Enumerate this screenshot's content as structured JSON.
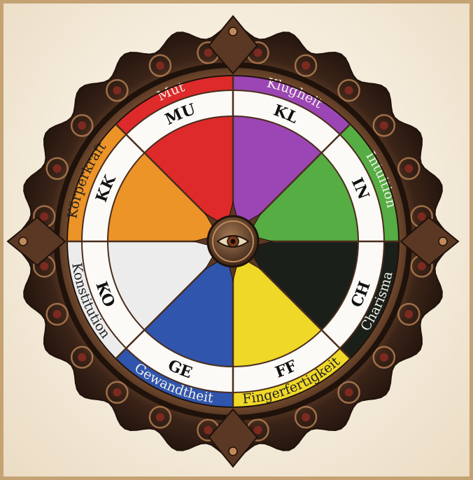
{
  "attributes": [
    {
      "abbr": "KL",
      "name": "Klugheit",
      "color": "#9b46b4",
      "light_text": true
    },
    {
      "abbr": "IN",
      "name": "Intuition",
      "color": "#55ad43",
      "light_text": true
    },
    {
      "abbr": "CH",
      "name": "Charisma",
      "color": "#1b1f1a",
      "light_text": true
    },
    {
      "abbr": "FF",
      "name": "Fingerfertigkeit",
      "color": "#f0d828",
      "light_text": false
    },
    {
      "abbr": "GE",
      "name": "Gewandtheit",
      "color": "#2f55ad",
      "light_text": true
    },
    {
      "abbr": "KO",
      "name": "Konstitution",
      "color": "#ececec",
      "light_text": false
    },
    {
      "abbr": "KK",
      "name": "Körperkraft",
      "color": "#ec9428",
      "light_text": false
    },
    {
      "abbr": "MU",
      "name": "Mut",
      "color": "#de2a2a",
      "light_text": true
    }
  ],
  "colors": {
    "ornament": "#3b2418",
    "ornament_highlight": "#8a5a36",
    "ornament_accent": "#7c2a20",
    "divider": "#4a2c1c",
    "parchment": "#f6eedf"
  },
  "center_icon": "eye-icon"
}
